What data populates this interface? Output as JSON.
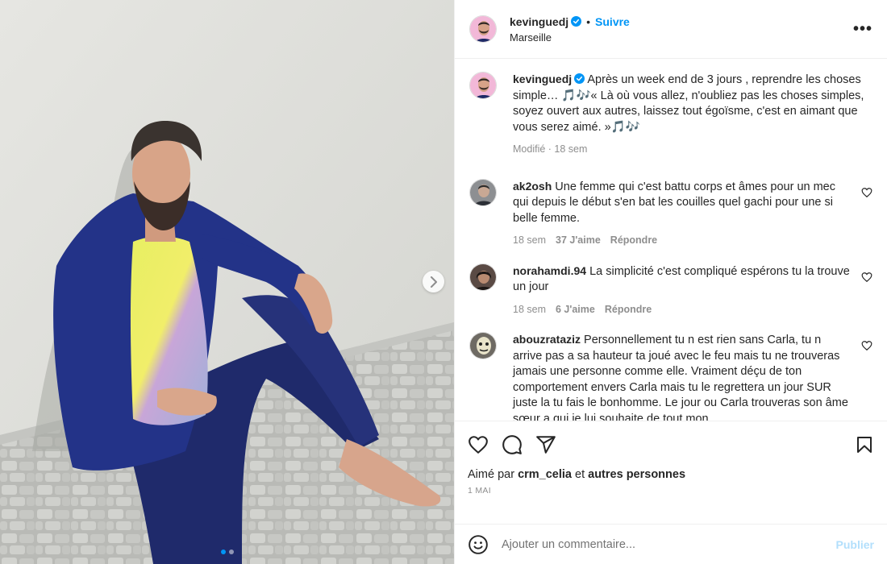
{
  "post": {
    "author": "kevinguedj",
    "follow_label": "Suivre",
    "separator": "•",
    "location": "Marseille",
    "more_label": "•••",
    "caption_author": "kevinguedj",
    "caption_text": "Après un week end de 3 jours , reprendre les choses simple… 🎵🎶« Là où vous allez, n'oubliez pas les choses simples, soyez ouvert aux autres, laissez tout égoïsme, c'est en aimant que vous serez aimé. »🎵🎶",
    "caption_meta": "Modifié · 18 sem",
    "carousel_dots": 2,
    "active_dot": 0
  },
  "comments": [
    {
      "user": "ak2osh",
      "text": "Une femme qui c'est battu corps et âmes pour un mec qui depuis le début s'en bat les couilles quel gachi pour une si belle femme.",
      "time": "18 sem",
      "likes": "37 J'aime",
      "reply": "Répondre"
    },
    {
      "user": "norahamdi.94",
      "text": "La simplicité c'est compliqué espérons tu la trouve un jour",
      "time": "18 sem",
      "likes": "6 J'aime",
      "reply": "Répondre"
    },
    {
      "user": "abouzrataziz",
      "text": "Personnellement tu n est rien sans Carla, tu n arrive pas a sa hauteur ta joué avec le feu mais tu ne trouveras jamais une personne comme elle. Vraiment déçu de ton comportement envers Carla mais tu le regrettera un jour SUR juste la tu fais le bonhomme. Le jour ou Carla trouveras son âme sœur a qui je lui souhaite de tout mon",
      "time": "",
      "likes": "",
      "reply": ""
    }
  ],
  "footer": {
    "liked_prefix": "Aimé par",
    "liked_user": "crm_celia",
    "liked_and": "et",
    "liked_others": "autres personnes",
    "date": "1 MAI",
    "comment_placeholder": "Ajouter un commentaire...",
    "publish_label": "Publier"
  },
  "colors": {
    "accent": "#0095f6",
    "muted": "#8e8e8e",
    "border": "#efefef",
    "publish_disabled": "#b2dffc"
  },
  "icons": {
    "verified": "verified-badge-icon",
    "next": "chevron-right-icon",
    "like": "heart-icon",
    "comment": "comment-bubble-icon",
    "share": "paper-plane-icon",
    "save": "bookmark-icon",
    "emoji": "smiley-icon",
    "more": "more-dots-icon"
  }
}
